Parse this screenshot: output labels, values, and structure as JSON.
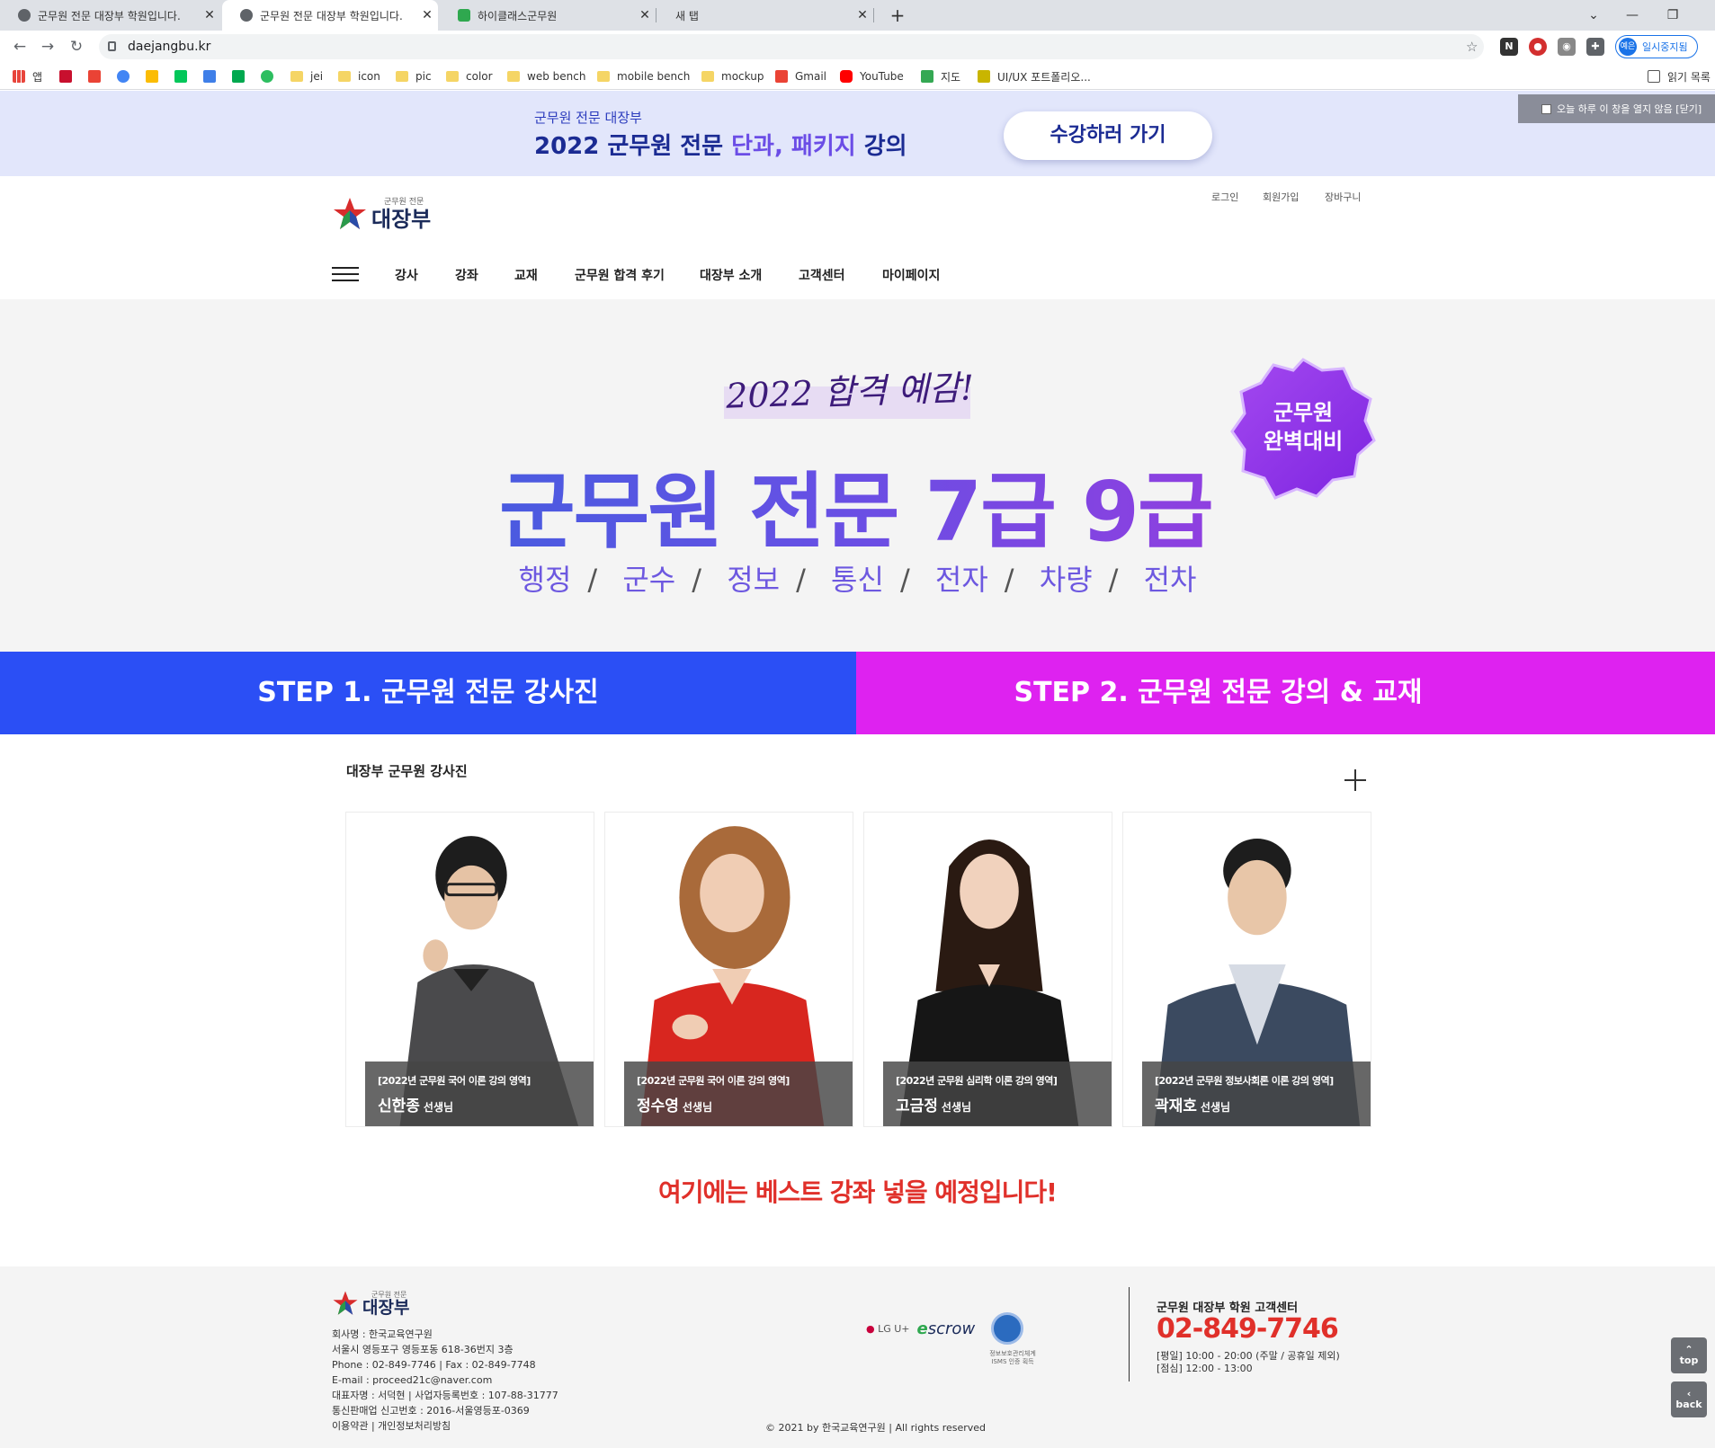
{
  "browser": {
    "tabs": [
      {
        "title": "군무원 전문 대장부 학원입니다."
      },
      {
        "title": "군무원 전문 대장부 학원입니다."
      },
      {
        "title": "하이클래스군무원"
      },
      {
        "title": "새 탭"
      }
    ],
    "url": "daejangbu.kr",
    "profile_avatar": "예은",
    "profile_label": "일시중지됨",
    "bookmarks": [
      "앱",
      "jei",
      "icon",
      "pic",
      "color",
      "web bench",
      "mobile bench",
      "mockup",
      "Gmail",
      "YouTube",
      "지도",
      "UI/UX 포트폴리오..."
    ],
    "reading_list": "읽기 목록"
  },
  "promo": {
    "subtitle": "군무원 전문 대장부",
    "title_prefix": "2022 군무원 전문 ",
    "title_highlight": "단과, 패키지",
    "title_suffix": " 강의",
    "button": "수강하러 가기",
    "close_today": "오늘 하루 이 창을 열지 않음 [닫기]"
  },
  "header": {
    "logo_small": "군무원 전문",
    "logo_big": "대장부",
    "util": [
      "로그인",
      "회원가입",
      "장바구니"
    ],
    "nav": [
      "강사",
      "강좌",
      "교재",
      "군무원 합격 후기",
      "대장부 소개",
      "고객센터",
      "마이페이지"
    ]
  },
  "hero": {
    "script": "2022 합격 예감!",
    "title": "군무원 전문 7급 9급",
    "badge_line1": "군무원",
    "badge_line2": "완벽대비",
    "subjects": [
      "행정",
      "군수",
      "정보",
      "통신",
      "전자",
      "차량",
      "전차"
    ]
  },
  "steps": {
    "step1": "STEP 1. 군무원 전문 강사진",
    "step2": "STEP 2. 군무원 전문 강의 & 교재"
  },
  "instructors": {
    "title": "대장부 군무원 강사진",
    "cards": [
      {
        "category": "[2022년 군무원 국어 이론 강의 영역]",
        "name": "신한종",
        "suffix": "선생님"
      },
      {
        "category": "[2022년 군무원 국어 이론 강의 영역]",
        "name": "정수영",
        "suffix": "선생님"
      },
      {
        "category": "[2022년 군무원 심리학 이론 강의 영역]",
        "name": "고금정",
        "suffix": "선생님"
      },
      {
        "category": "[2022년 군무원 정보사회론 이론 강의 영역]",
        "name": "곽재호",
        "suffix": "선생님"
      }
    ]
  },
  "best_notice": "여기에는 베스트 강좌 넣을 예정입니다!",
  "footer": {
    "logo_small": "군무원 전문",
    "logo_big": "대장부",
    "info": [
      "회사명 : 한국교육연구원",
      "서울시 영등포구 영등포동 618-36번지 3층",
      "Phone : 02-849-7746  |  Fax : 02-849-7748",
      "E-mail : proceed21c@naver.com",
      "대표자명 : 서덕현  |  사업자등록번호 : 107-88-31777",
      "통신판매업 신고번호 : 2016-서울영등포-0369",
      "이용약관  |  개인정보처리방침"
    ],
    "partner_lgu": "LG U+",
    "partner_escrow": "scrow",
    "isms_text": "정보보호관리체계 ISMS 인증 획득",
    "copyright": "© 2021 by 한국교육연구원  |  All rights reserved",
    "cc_title": "군무원 대장부 학원 고객센터",
    "cc_phone": "02-849-7746",
    "cc_hours_1": "[평일] 10:00 - 20:00 (주말 / 공휴일 제외)",
    "cc_hours_2": "[점심] 12:00 - 13:00"
  },
  "float": {
    "top": "top",
    "back": "back"
  },
  "colors": {
    "step1": "#2b4ff5",
    "step2": "#de22f0",
    "accent_red": "#e0302a",
    "hero_purple": "#6d58e0"
  }
}
